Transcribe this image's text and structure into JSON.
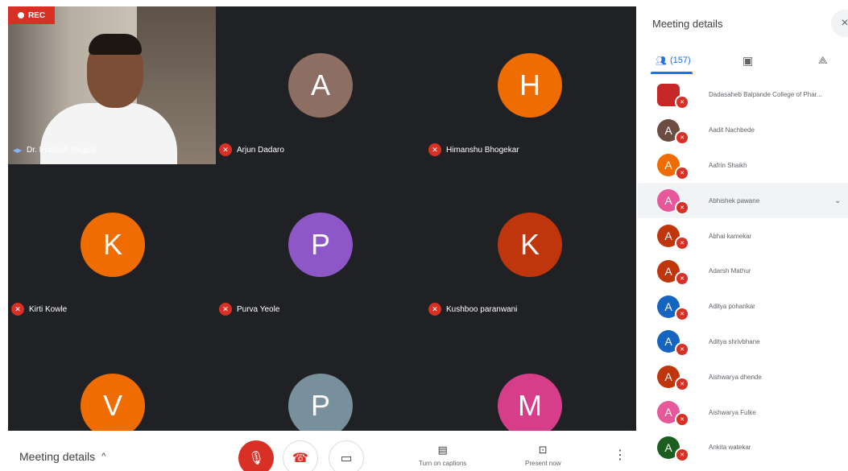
{
  "recording": {
    "label": "REC"
  },
  "main_speaker": {
    "name": "Dr. Prakash Nagpal"
  },
  "grid": [
    {
      "letter": "A",
      "name": "Arjun Dadaro",
      "color": "#8d6e63"
    },
    {
      "letter": "H",
      "name": "Himanshu Bhogekar",
      "color": "#ef6c00"
    },
    {
      "letter": "K",
      "name": "Kirti Kowle",
      "color": "#ef6c00"
    },
    {
      "letter": "P",
      "name": "Purva Yeole",
      "color": "#8e57c8"
    },
    {
      "letter": "K",
      "name": "Kushboo paranwani",
      "color": "#bf360c"
    },
    {
      "letter": "V",
      "name": "",
      "color": "#ef6c00"
    },
    {
      "letter": "P",
      "name": "",
      "color": "#78909c"
    },
    {
      "letter": "M",
      "name": "",
      "color": "#d63e8a"
    }
  ],
  "bottombar": {
    "meeting_details": "Meeting details",
    "chevron": "^",
    "captions": "Turn on captions",
    "present": "Present now"
  },
  "panel": {
    "title": "Meeting details",
    "close_icon": "×",
    "tabs": {
      "people_count": "(157)"
    }
  },
  "participants": [
    {
      "letter": "",
      "name": "Dadasaheb Balpande College of Phar...",
      "color": "#c62828"
    },
    {
      "letter": "A",
      "name": "Aadit Nachbede",
      "color": "#6d4c41"
    },
    {
      "letter": "A",
      "name": "Aafrin Shaikh",
      "color": "#ef6c00"
    },
    {
      "letter": "A",
      "name": "Abhishek pawane",
      "color": "#e7589b"
    },
    {
      "letter": "A",
      "name": "Abhai kamekar",
      "color": "#bf360c"
    },
    {
      "letter": "A",
      "name": "Adarsh Mathur",
      "color": "#bf360c"
    },
    {
      "letter": "A",
      "name": "Aditya pohankar",
      "color": "#1565c0"
    },
    {
      "letter": "A",
      "name": "Aditya shrivbhane",
      "color": "#1565c0"
    },
    {
      "letter": "A",
      "name": "Aishwarya dhende",
      "color": "#bf360c"
    },
    {
      "letter": "A",
      "name": "Aishwarya Fulke",
      "color": "#e7589b"
    },
    {
      "letter": "A",
      "name": "Ankita watekar",
      "color": "#1b5e20"
    }
  ]
}
